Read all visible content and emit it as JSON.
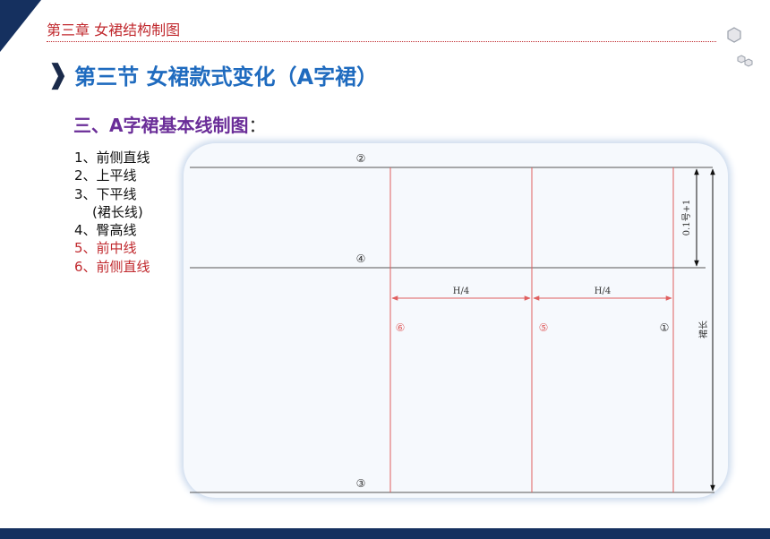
{
  "header": {
    "chapter": "第三章  女裙结构制图"
  },
  "title": {
    "text": "第三节  女裙款式变化（A字裙）"
  },
  "subtitle": {
    "text": "三、A字裙基本线制图",
    "colon": "："
  },
  "legend": {
    "items": [
      {
        "text": "1、前侧直线"
      },
      {
        "text": "2、上平线"
      },
      {
        "text": "3、下平线"
      },
      {
        "text": "(裙长线)"
      },
      {
        "text": "4、臀高线"
      },
      {
        "text": "5、前中线"
      },
      {
        "text": "6、前侧直线"
      }
    ]
  },
  "diagram": {
    "line_labels": {
      "two": "②",
      "four": "④",
      "three": "③",
      "six": "⑥",
      "five": "⑤",
      "one": "①"
    },
    "dims": {
      "h4_left": "H/4",
      "h4_right": "H/4",
      "hip_height": "0.1号+1",
      "skirt_length": "裙长"
    }
  },
  "colors": {
    "navy": "#15305f",
    "title_blue": "#1f6bbf",
    "subtitle_purple": "#6a2d98",
    "red": "#c0282d",
    "line_red": "#e06060"
  }
}
